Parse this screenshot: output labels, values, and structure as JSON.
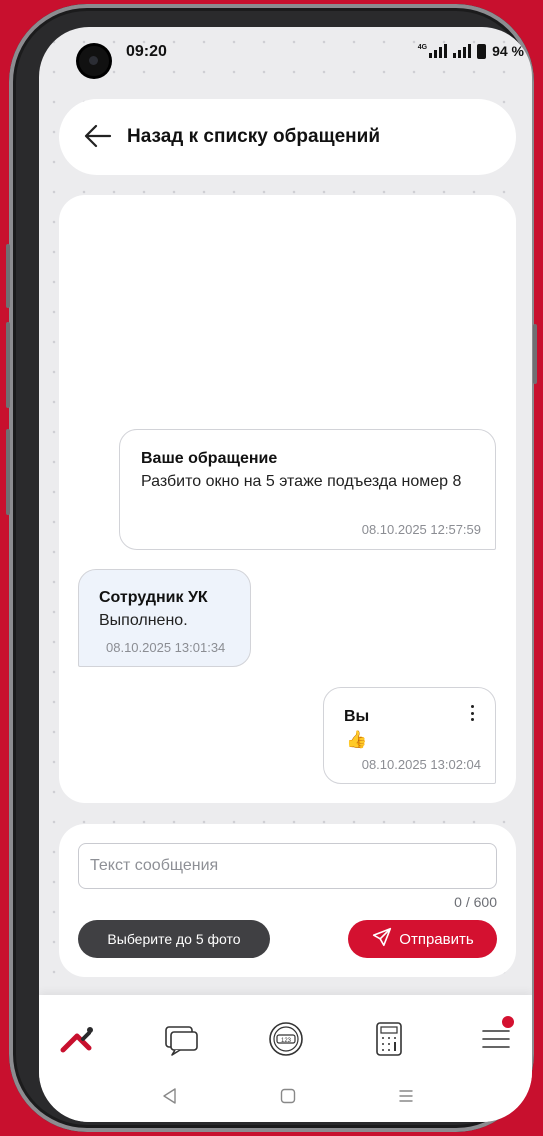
{
  "status_bar": {
    "time": "09:20",
    "network": "4G",
    "battery": "94 %"
  },
  "header": {
    "back_icon": "arrow-left-icon",
    "title": "Назад к списку обращений"
  },
  "messages": [
    {
      "author": "Ваше обращение",
      "text": "Разбито окно на 5 этаже подъезда номер 8",
      "timestamp": "08.10.2025 12:57:59"
    },
    {
      "author": "Сотрудник УК",
      "text": "Выполнено.",
      "timestamp": "08.10.2025 13:01:34"
    },
    {
      "author": "Вы",
      "text": "👍",
      "timestamp": "08.10.2025 13:02:04",
      "menu_icon": "more-vertical-icon"
    }
  ],
  "compose": {
    "placeholder": "Текст сообщения",
    "value": "",
    "counter": "0 / 600",
    "photo_button": "Выберите до 5 фото",
    "send_button": "Отправить",
    "send_icon": "send-icon"
  },
  "tab_bar": {
    "items": [
      {
        "icon": "home-logo-icon"
      },
      {
        "icon": "chat-icon"
      },
      {
        "icon": "meter-icon"
      },
      {
        "icon": "calculator-icon"
      },
      {
        "icon": "menu-icon",
        "has_notification": true
      }
    ]
  },
  "system_nav": [
    "back-triangle-icon",
    "home-square-icon",
    "recents-lines-icon"
  ],
  "colors": {
    "accent": "#d41130",
    "background": "#c8102e",
    "dark_button": "#404043",
    "staff_bubble": "#eef3fb"
  }
}
